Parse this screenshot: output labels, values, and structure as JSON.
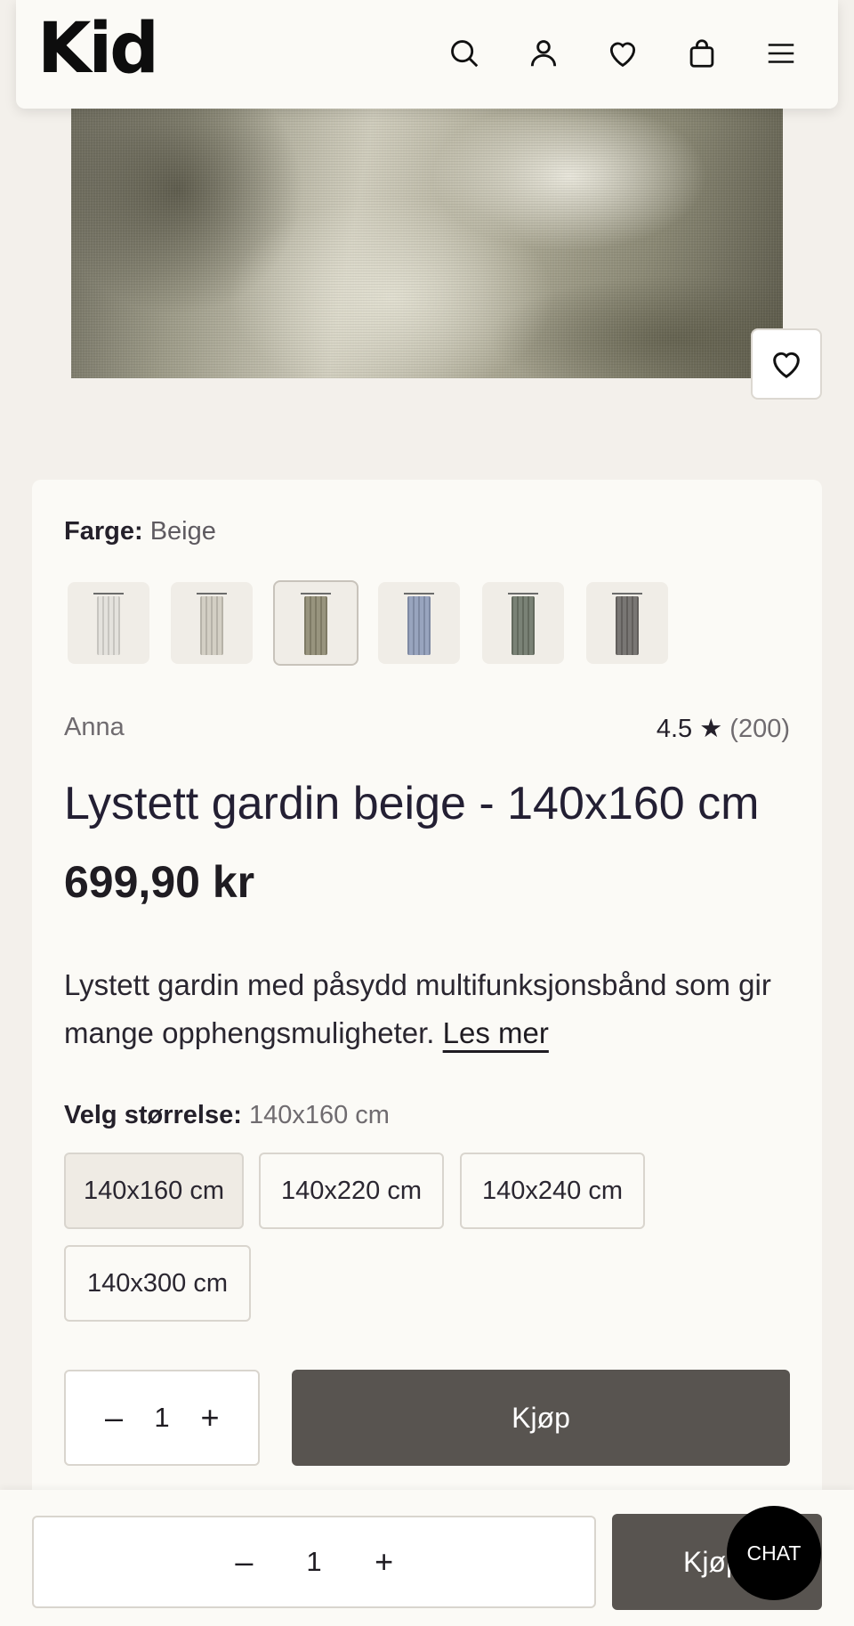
{
  "header": {
    "logo": "Kid",
    "icons": [
      "search-icon",
      "user-icon",
      "heart-icon",
      "bag-icon",
      "menu-icon"
    ]
  },
  "product": {
    "color_label": "Farge:",
    "color_value": "Beige",
    "swatches": [
      {
        "name": "white",
        "color": "#e2e0da"
      },
      {
        "name": "light-beige",
        "color": "#cfcbbf"
      },
      {
        "name": "beige",
        "color": "#8f8b73",
        "selected": true
      },
      {
        "name": "blue",
        "color": "#8f9cb8"
      },
      {
        "name": "green",
        "color": "#6f776a"
      },
      {
        "name": "grey",
        "color": "#6e6b68"
      }
    ],
    "brand": "Anna",
    "rating_score": "4.5",
    "rating_star": "★",
    "rating_count": "(200)",
    "title": "Lystett gardin beige - 140x160 cm",
    "price": "699,90 kr",
    "description": "Lystett gardin med påsydd multifunksjonsbånd som gir mange opphengsmuligheter.",
    "read_more": "Les mer",
    "size_label": "Velg størrelse:",
    "size_value": "140x160 cm",
    "sizes": [
      "140x160 cm",
      "140x220 cm",
      "140x240 cm",
      "140x300 cm"
    ],
    "quantity": "1",
    "minus": "–",
    "plus": "+",
    "buy_label": "Kjøp"
  },
  "sticky": {
    "quantity": "1",
    "minus": "–",
    "plus": "+",
    "buy_label": "Kjøp"
  },
  "chat_label": "CHAT",
  "colors": {
    "background": "#f3f0eb",
    "card": "#fbfaf6",
    "buy_button": "#585450",
    "chat_button": "#000000"
  }
}
